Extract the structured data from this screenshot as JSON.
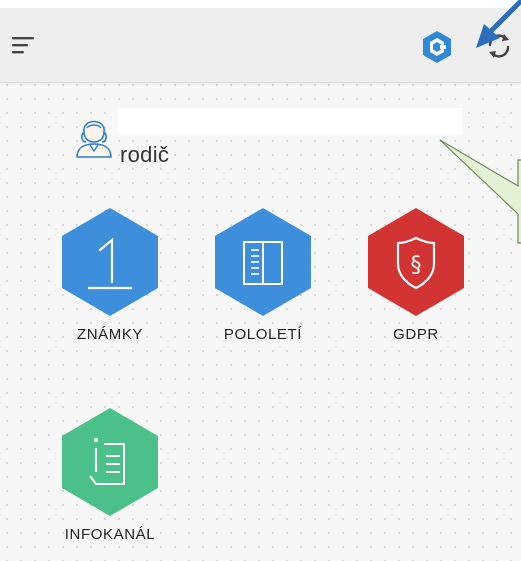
{
  "topbar": {
    "menu_icon": "hamburger-icon",
    "logo_icon": "hexagon-logo-icon",
    "refresh_icon": "refresh-icon"
  },
  "user": {
    "name": "",
    "role": "rodič",
    "avatar_icon": "user-avatar-icon"
  },
  "tiles": [
    {
      "label": "ZNÁMKY",
      "icon": "number-one-icon",
      "color": "#3d8fdc"
    },
    {
      "label": "POLOLETÍ",
      "icon": "report-book-icon",
      "color": "#3d8fdc"
    },
    {
      "label": "GDPR",
      "icon": "shield-section-icon",
      "color": "#d23434"
    },
    {
      "label": "INFOKANÁL",
      "icon": "info-list-icon",
      "color": "#4cc089"
    }
  ],
  "colors": {
    "blue": "#3d8fdc",
    "red": "#d23434",
    "green": "#4cc089",
    "annotation_arrow": "#2a6ebd",
    "callout_fill": "#e3f1d4"
  }
}
